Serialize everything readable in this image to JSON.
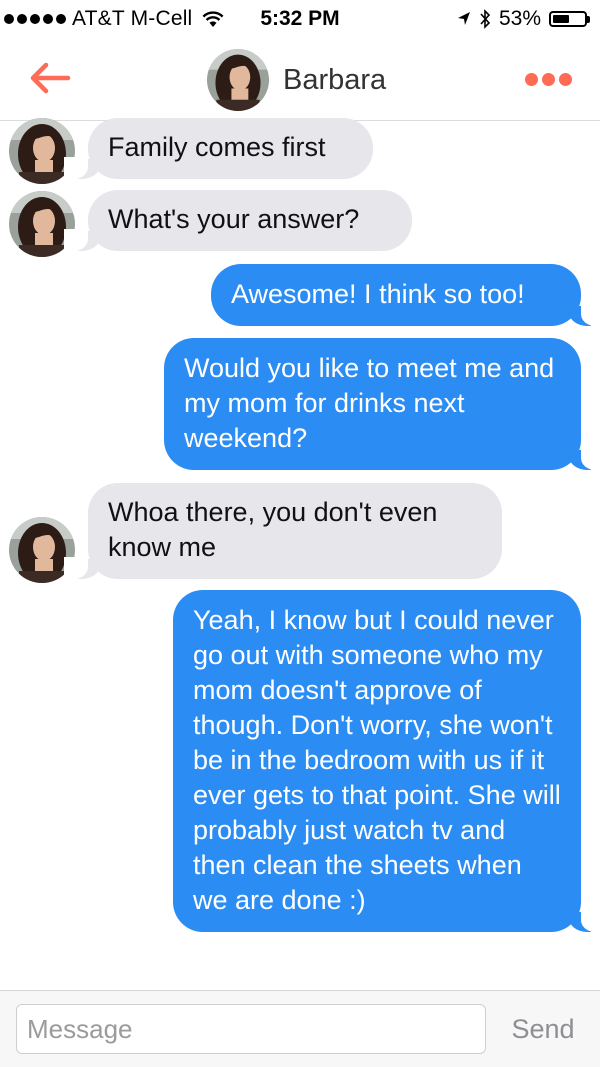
{
  "status_bar": {
    "carrier": "AT&T M-Cell",
    "time": "5:32 PM",
    "battery": "53%",
    "battery_level": 0.53,
    "signal_dots": 5
  },
  "header": {
    "name": "Barbara",
    "back_icon": "arrow-left-icon",
    "more_icon": "more-dots-icon",
    "accent_color": "#fe6c55"
  },
  "messages": [
    {
      "from": "them",
      "text": "Family comes first"
    },
    {
      "from": "them",
      "text": "What's your answer?"
    },
    {
      "from": "me",
      "text": "Awesome! I think so too!"
    },
    {
      "from": "me",
      "text": "Would you like to meet me and my mom for drinks next weekend?"
    },
    {
      "from": "them",
      "text": "Whoa there, you don't even know me"
    },
    {
      "from": "me",
      "text": "Yeah, I know but I could never go out with someone who my mom doesn't approve of though. Don't worry, she won't be in the bedroom with us if it ever gets to that point. She will probably just watch tv and then clean the sheets when we are done :)"
    }
  ],
  "composer": {
    "placeholder": "Message",
    "send_label": "Send"
  },
  "colors": {
    "outgoing_bubble": "#2b8cf3",
    "incoming_bubble": "#e6e6eb"
  }
}
